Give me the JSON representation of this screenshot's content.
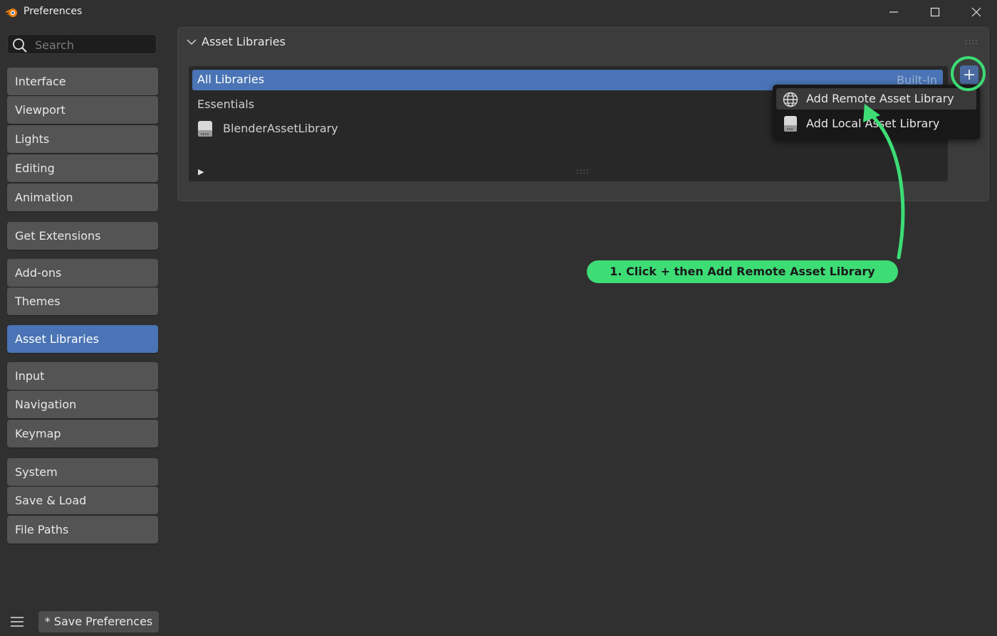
{
  "window": {
    "title": "Preferences",
    "minimize_icon": "minimize-icon",
    "maximize_icon": "maximize-icon",
    "close_icon": "close-icon"
  },
  "search": {
    "placeholder": "Search",
    "icon": "search-icon"
  },
  "sidebar": {
    "groups": [
      [
        "Interface",
        "Viewport",
        "Lights",
        "Editing",
        "Animation"
      ],
      [
        "Get Extensions"
      ],
      [
        "Add-ons",
        "Themes"
      ],
      [
        "Asset Libraries"
      ],
      [
        "Input",
        "Navigation",
        "Keymap"
      ],
      [
        "System",
        "Save & Load",
        "File Paths"
      ]
    ],
    "active": "Asset Libraries"
  },
  "bottom": {
    "save_label": "* Save Preferences",
    "menu_icon": "hamburger-menu-icon"
  },
  "panel": {
    "title": "Asset Libraries",
    "libraries": {
      "selected_label": "All Libraries",
      "selected_tag": "Built-In",
      "section_label": "Essentials",
      "library_name": "BlenderAssetLibrary"
    },
    "add_button_icon": "plus-icon"
  },
  "popup": {
    "items": [
      {
        "label": "Add Remote Asset Library",
        "icon": "globe-icon"
      },
      {
        "label": "Add Local Asset Library",
        "icon": "drive-icon"
      }
    ]
  },
  "annotation": {
    "text": "1. Click + then Add Remote Asset Library",
    "color": "#3ddc75"
  },
  "colors": {
    "accent": "#4a74b5",
    "background": "#303030",
    "annotation": "#3ddc75"
  }
}
